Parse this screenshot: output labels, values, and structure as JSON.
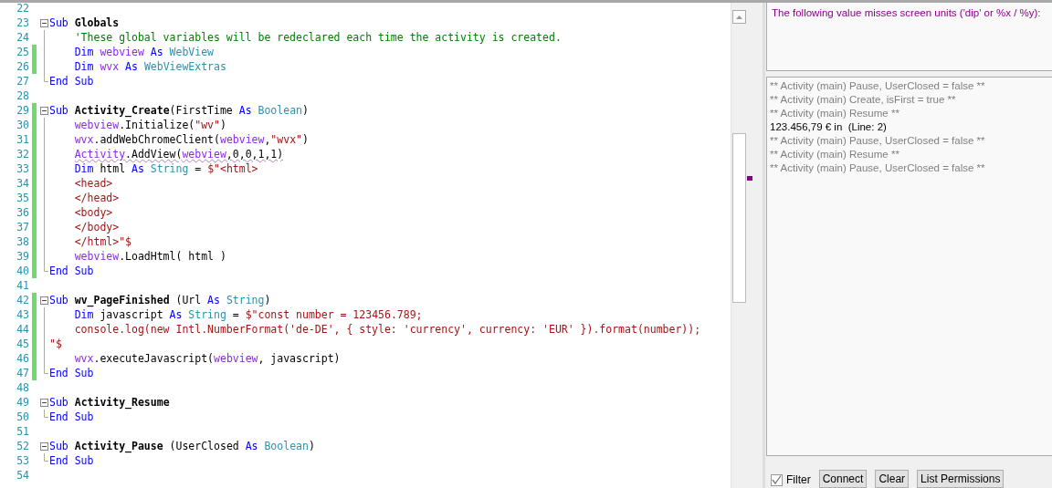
{
  "editor": {
    "lines": [
      {
        "n": "22",
        "changed": false
      },
      {
        "n": "23",
        "changed": false,
        "kind": "block-start",
        "indented": false,
        "tokens": [
          {
            "t": "Sub ",
            "kind": "keyword"
          },
          {
            "t": "Globals",
            "kind": "name"
          }
        ]
      },
      {
        "n": "24",
        "changed": false,
        "kind": "block-body",
        "indented": true,
        "tokens": [
          {
            "t": "'These global variables will be redeclared each time the activity is created.",
            "kind": "comment"
          }
        ]
      },
      {
        "n": "25",
        "changed": true,
        "kind": "block-body",
        "indented": true,
        "tokens": [
          {
            "t": "Dim ",
            "kind": "keyword"
          },
          {
            "t": "webview ",
            "kind": "identifier"
          },
          {
            "t": "As ",
            "kind": "keyword"
          },
          {
            "t": "WebView",
            "kind": "type"
          }
        ]
      },
      {
        "n": "26",
        "changed": true,
        "kind": "block-body",
        "indented": true,
        "tokens": [
          {
            "t": "Dim ",
            "kind": "keyword"
          },
          {
            "t": "wvx ",
            "kind": "identifier"
          },
          {
            "t": "As ",
            "kind": "keyword"
          },
          {
            "t": "WebViewExtras",
            "kind": "type"
          }
        ]
      },
      {
        "n": "27",
        "changed": false,
        "kind": "block-end",
        "indented": false,
        "tokens": [
          {
            "t": "End Sub",
            "kind": "keyword"
          }
        ]
      },
      {
        "n": "28",
        "changed": false
      },
      {
        "n": "29",
        "changed": true,
        "kind": "block-start",
        "indented": false,
        "tokens": [
          {
            "t": "Sub ",
            "kind": "keyword"
          },
          {
            "t": "Activity_Create",
            "kind": "name"
          },
          {
            "t": "(FirstTime ",
            "kind": "plain"
          },
          {
            "t": "As ",
            "kind": "keyword"
          },
          {
            "t": "Boolean",
            "kind": "type"
          },
          {
            "t": ")",
            "kind": "plain"
          }
        ]
      },
      {
        "n": "30",
        "changed": true,
        "kind": "block-body",
        "indented": true,
        "tokens": [
          {
            "t": "webview",
            "kind": "identifier"
          },
          {
            "t": ".Initialize(",
            "kind": "plain"
          },
          {
            "t": "\"wv\"",
            "kind": "string"
          },
          {
            "t": ")",
            "kind": "plain"
          }
        ]
      },
      {
        "n": "31",
        "changed": true,
        "kind": "block-body",
        "indented": true,
        "tokens": [
          {
            "t": "wvx",
            "kind": "identifier"
          },
          {
            "t": ".addWebChromeClient(",
            "kind": "plain"
          },
          {
            "t": "webview",
            "kind": "identifier"
          },
          {
            "t": ",",
            "kind": "plain"
          },
          {
            "t": "\"wvx\"",
            "kind": "string"
          },
          {
            "t": ")",
            "kind": "plain"
          }
        ]
      },
      {
        "n": "32",
        "changed": true,
        "kind": "block-body",
        "indented": true,
        "tokens": [
          {
            "t": "Activity",
            "kind": "identifier",
            "squiggle": true
          },
          {
            "t": ".AddView(",
            "kind": "plain",
            "squiggle": true
          },
          {
            "t": "webview",
            "kind": "identifier",
            "squiggle": true
          },
          {
            "t": ",0,0,1,1)",
            "kind": "plain",
            "squiggle": true
          }
        ]
      },
      {
        "n": "33",
        "changed": true,
        "kind": "block-body",
        "indented": true,
        "tokens": [
          {
            "t": "Dim ",
            "kind": "keyword"
          },
          {
            "t": "html ",
            "kind": "plain"
          },
          {
            "t": "As ",
            "kind": "keyword"
          },
          {
            "t": "String",
            "kind": "type"
          },
          {
            "t": " = ",
            "kind": "plain"
          },
          {
            "t": "$\"<html>",
            "kind": "string"
          }
        ]
      },
      {
        "n": "34",
        "changed": true,
        "kind": "block-body",
        "indented": true,
        "tokens": [
          {
            "t": "<head>",
            "kind": "string"
          }
        ]
      },
      {
        "n": "35",
        "changed": true,
        "kind": "block-body",
        "indented": true,
        "tokens": [
          {
            "t": "</head>",
            "kind": "string"
          }
        ]
      },
      {
        "n": "36",
        "changed": true,
        "kind": "block-body",
        "indented": true,
        "tokens": [
          {
            "t": "<body>",
            "kind": "string"
          }
        ]
      },
      {
        "n": "37",
        "changed": true,
        "kind": "block-body",
        "indented": true,
        "tokens": [
          {
            "t": "</body>",
            "kind": "string"
          }
        ]
      },
      {
        "n": "38",
        "changed": true,
        "kind": "block-body",
        "indented": true,
        "tokens": [
          {
            "t": "</html>\"$",
            "kind": "string"
          }
        ]
      },
      {
        "n": "39",
        "changed": true,
        "kind": "block-body",
        "indented": true,
        "tokens": [
          {
            "t": "webview",
            "kind": "identifier"
          },
          {
            "t": ".LoadHtml( html )",
            "kind": "plain"
          }
        ]
      },
      {
        "n": "40",
        "changed": true,
        "kind": "block-end",
        "indented": false,
        "tokens": [
          {
            "t": "End Sub",
            "kind": "keyword"
          }
        ]
      },
      {
        "n": "41",
        "changed": false
      },
      {
        "n": "42",
        "changed": true,
        "kind": "block-start",
        "indented": false,
        "tokens": [
          {
            "t": "Sub ",
            "kind": "keyword"
          },
          {
            "t": "wv_PageFinished",
            "kind": "name"
          },
          {
            "t": " (Url ",
            "kind": "plain"
          },
          {
            "t": "As ",
            "kind": "keyword"
          },
          {
            "t": "String",
            "kind": "type"
          },
          {
            "t": ")",
            "kind": "plain"
          }
        ]
      },
      {
        "n": "43",
        "changed": true,
        "kind": "block-body",
        "indented": true,
        "tokens": [
          {
            "t": "Dim ",
            "kind": "keyword"
          },
          {
            "t": "javascript ",
            "kind": "plain"
          },
          {
            "t": "As ",
            "kind": "keyword"
          },
          {
            "t": "String",
            "kind": "type"
          },
          {
            "t": " = ",
            "kind": "plain"
          },
          {
            "t": "$\"const number = 123456.789;",
            "kind": "string"
          }
        ]
      },
      {
        "n": "44",
        "changed": true,
        "kind": "block-body",
        "indented": true,
        "tokens": [
          {
            "t": "console.log(new Intl.NumberFormat('de-DE', { style: 'currency', currency: 'EUR' }).format(number));",
            "kind": "string"
          }
        ]
      },
      {
        "n": "45",
        "changed": true,
        "kind": "block-body",
        "indented": false,
        "tokens": [
          {
            "t": "\"$",
            "kind": "string"
          }
        ]
      },
      {
        "n": "46",
        "changed": true,
        "kind": "block-body",
        "indented": true,
        "tokens": [
          {
            "t": "wvx",
            "kind": "identifier"
          },
          {
            "t": ".executeJavascript(",
            "kind": "plain"
          },
          {
            "t": "webview",
            "kind": "identifier"
          },
          {
            "t": ", javascript)",
            "kind": "plain"
          }
        ]
      },
      {
        "n": "47",
        "changed": true,
        "kind": "block-end",
        "indented": false,
        "tokens": [
          {
            "t": "End Sub",
            "kind": "keyword"
          }
        ]
      },
      {
        "n": "48",
        "changed": false
      },
      {
        "n": "49",
        "changed": false,
        "kind": "block-start",
        "indented": false,
        "tokens": [
          {
            "t": "Sub ",
            "kind": "keyword"
          },
          {
            "t": "Activity_Resume",
            "kind": "name"
          }
        ]
      },
      {
        "n": "50",
        "changed": false,
        "kind": "block-end",
        "indented": false,
        "tokens": [
          {
            "t": "End Sub",
            "kind": "keyword"
          }
        ]
      },
      {
        "n": "51",
        "changed": false
      },
      {
        "n": "52",
        "changed": false,
        "kind": "block-start",
        "indented": false,
        "tokens": [
          {
            "t": "Sub ",
            "kind": "keyword"
          },
          {
            "t": "Activity_Pause",
            "kind": "name"
          },
          {
            "t": " (UserClosed ",
            "kind": "plain"
          },
          {
            "t": "As ",
            "kind": "keyword"
          },
          {
            "t": "Boolean",
            "kind": "type"
          },
          {
            "t": ")",
            "kind": "plain"
          }
        ]
      },
      {
        "n": "53",
        "changed": false,
        "kind": "block-end",
        "indented": false,
        "tokens": [
          {
            "t": "End Sub",
            "kind": "keyword"
          }
        ]
      },
      {
        "n": "54",
        "changed": false
      }
    ]
  },
  "warnings": [
    "The following value misses screen units ('dip' or %x / %y):"
  ],
  "log": [
    {
      "text": "** Activity (main) Pause, UserClosed = false **",
      "kind": "system"
    },
    {
      "text": "** Activity (main) Create, isFirst = true **",
      "kind": "system"
    },
    {
      "text": "** Activity (main) Resume **",
      "kind": "system"
    },
    {
      "text": "123.456,79 € in  (Line: 2)",
      "kind": "output"
    },
    {
      "text": "** Activity (main) Pause, UserClosed = false **",
      "kind": "system"
    },
    {
      "text": "** Activity (main) Resume **",
      "kind": "system"
    },
    {
      "text": "** Activity (main) Pause, UserClosed = false **",
      "kind": "system"
    }
  ],
  "filter": {
    "label": "Filter",
    "checked": true
  },
  "buttons": [
    "Connect",
    "Clear",
    "List Permissions"
  ]
}
